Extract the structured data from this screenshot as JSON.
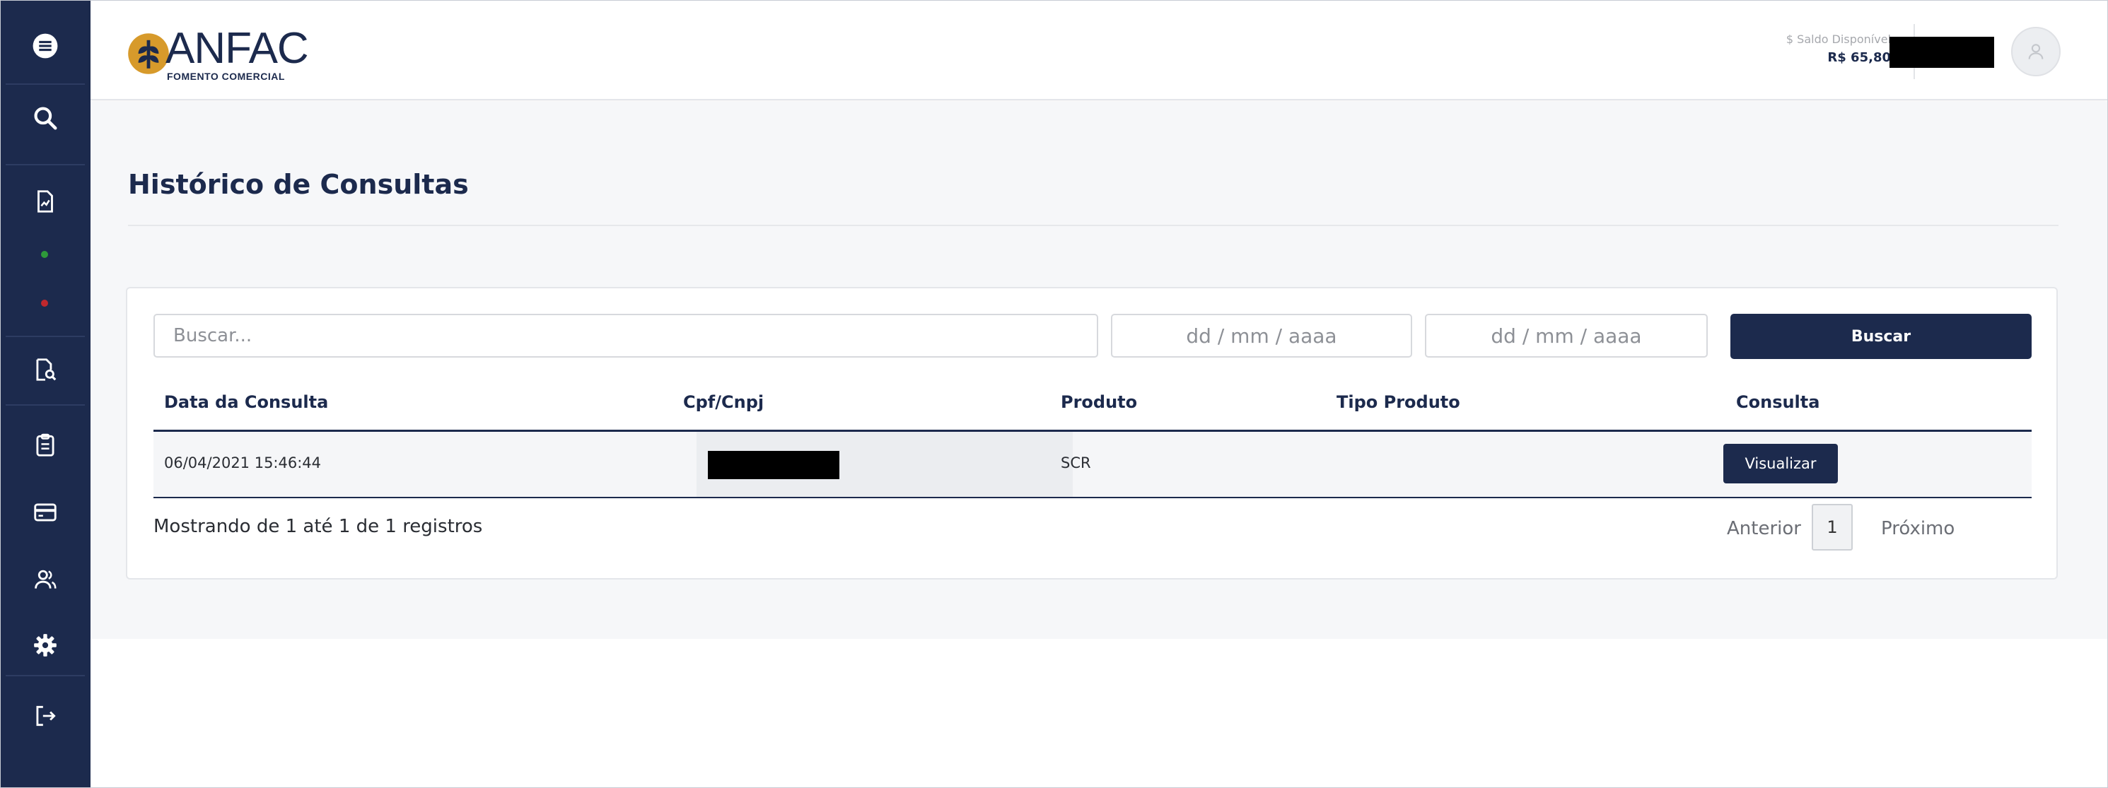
{
  "sidebar": {
    "items": [
      {
        "name": "menu-icon"
      },
      {
        "name": "search-icon"
      },
      {
        "name": "document-chart-icon"
      },
      {
        "name": "status-dot-green"
      },
      {
        "name": "status-dot-red"
      },
      {
        "name": "document-search-icon"
      },
      {
        "name": "clipboard-icon"
      },
      {
        "name": "credit-card-icon"
      },
      {
        "name": "users-icon"
      },
      {
        "name": "gear-icon"
      },
      {
        "name": "logout-icon"
      }
    ]
  },
  "header": {
    "logo_text": "ANFAC",
    "logo_subtext": "FOMENTO COMERCIAL",
    "saldo_label": "$ Saldo Disponível",
    "saldo_value": "R$ 65,80"
  },
  "page": {
    "title": "Histórico de Consultas"
  },
  "filters": {
    "search_placeholder": "Buscar...",
    "date_from_placeholder": "dd / mm / aaaa",
    "date_to_placeholder": "dd / mm / aaaa",
    "search_button": "Buscar"
  },
  "table": {
    "columns": [
      "Data da Consulta",
      "Cpf/Cnpj",
      "Produto",
      "Tipo Produto",
      "Consulta"
    ],
    "rows": [
      {
        "data": "06/04/2021 15:46:44",
        "cpf": "",
        "produto": "SCR",
        "tipo": "",
        "action": "Visualizar"
      }
    ]
  },
  "footer": {
    "info": "Mostrando de 1 até 1 de 1 registros",
    "prev": "Anterior",
    "page": "1",
    "next": "Próximo"
  },
  "colors": {
    "primary": "#1c2a4d",
    "status_green": "#2e9a3a",
    "status_red": "#c0282d"
  }
}
